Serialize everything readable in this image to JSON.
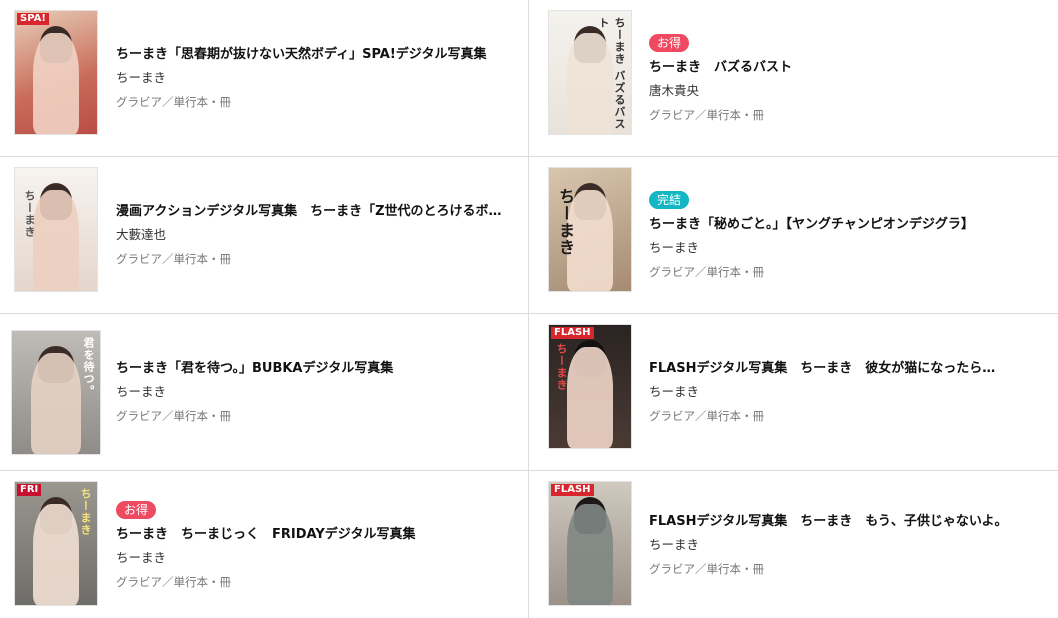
{
  "colors": {
    "badge_sale": "#ee4a62",
    "badge_complete": "#14b6c4",
    "divider": "#dcdcdc"
  },
  "items": [
    {
      "title": "ちーまき「思春期が抜けない天然ボディ」SPA!デジタル写真集",
      "author": "ちーまき",
      "category": "グラビア／単行本・冊",
      "badge": "",
      "cover_brand": "SPA!",
      "cover_text": ""
    },
    {
      "title": "ちーまき　バズるバスト",
      "author": "唐木貴央",
      "category": "グラビア／単行本・冊",
      "badge": "お得",
      "cover_brand": "",
      "cover_text": "ちーまき バズるバスト"
    },
    {
      "title": "漫画アクションデジタル写真集　ちーまき「Z世代のとろけるボディ」",
      "author": "大藪達也",
      "category": "グラビア／単行本・冊",
      "badge": "",
      "cover_brand": "",
      "cover_text": "ちーまき"
    },
    {
      "title": "ちーまき「秘めごと。」【ヤングチャンピオンデジグラ】",
      "author": "ちーまき",
      "category": "グラビア／単行本・冊",
      "badge": "完結",
      "cover_brand": "",
      "cover_text": "ちーまき"
    },
    {
      "title": "ちーまき「君を待つ。」BUBKAデジタル写真集",
      "author": "ちーまき",
      "category": "グラビア／単行本・冊",
      "badge": "",
      "cover_brand": "",
      "cover_text": "君を待つ。"
    },
    {
      "title": "FLASHデジタル写真集　ちーまき　彼女が猫になったら…",
      "author": "ちーまき",
      "category": "グラビア／単行本・冊",
      "badge": "",
      "cover_brand": "FLASH",
      "cover_text": "ちーまき"
    },
    {
      "title": "ちーまき　ちーまじっく　FRIDAYデジタル写真集",
      "author": "ちーまき",
      "category": "グラビア／単行本・冊",
      "badge": "お得",
      "cover_brand": "FRI",
      "cover_text": "ちーまき"
    },
    {
      "title": "FLASHデジタル写真集　ちーまき　もう、子供じゃないよ。",
      "author": "ちーまき",
      "category": "グラビア／単行本・冊",
      "badge": "",
      "cover_brand": "FLASH",
      "cover_text": ""
    }
  ]
}
